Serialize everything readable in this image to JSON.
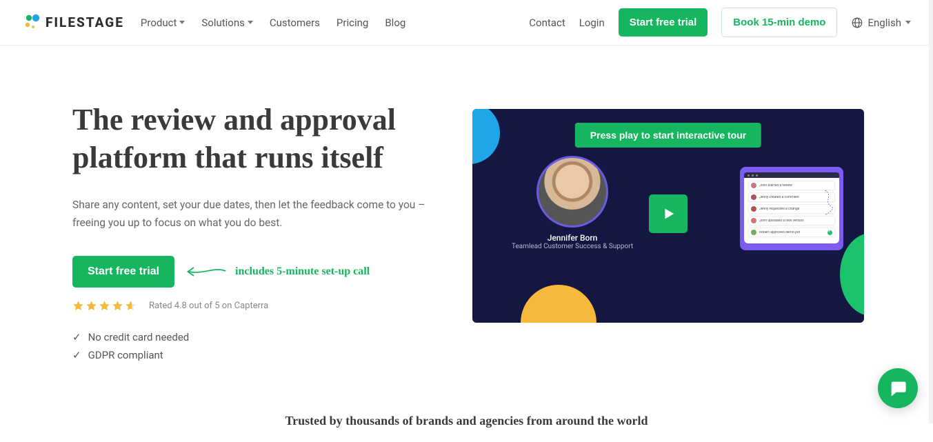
{
  "brand": {
    "name": "FILESTAGE"
  },
  "nav": {
    "left": [
      {
        "label": "Product",
        "dropdown": true
      },
      {
        "label": "Solutions",
        "dropdown": true
      },
      {
        "label": "Customers",
        "dropdown": false
      },
      {
        "label": "Pricing",
        "dropdown": false
      },
      {
        "label": "Blog",
        "dropdown": false
      }
    ],
    "right": {
      "contact": "Contact",
      "login": "Login",
      "trial": "Start free trial",
      "demo": "Book 15-min demo",
      "language": "English"
    }
  },
  "hero": {
    "title": "The review and approval platform that runs itself",
    "subtitle": "Share any content, set your due dates, then let the feedback come to you – freeing you up to focus on what you do best.",
    "cta": "Start free trial",
    "cta_note": "includes 5-minute set-up call",
    "rating_text": "Rated 4.8 out of 5 on Capterra",
    "checks": [
      "No credit card needed",
      "GDPR compliant"
    ]
  },
  "video": {
    "tour_label": "Press play to start interactive tour",
    "presenter_name": "Jennifer Born",
    "presenter_role": "Teamlead Customer Success & Support",
    "feed": [
      {
        "text": "John started a review"
      },
      {
        "text": "Jenny created a comment"
      },
      {
        "text": "Jenny requested a change"
      },
      {
        "text": "John uploaded a new version"
      },
      {
        "text": "Robert approved demo.pdf",
        "check": true
      }
    ]
  },
  "trust": {
    "headline": "Trusted by thousands of brands and agencies from around the world"
  },
  "colors": {
    "accent": "#16b55f"
  }
}
